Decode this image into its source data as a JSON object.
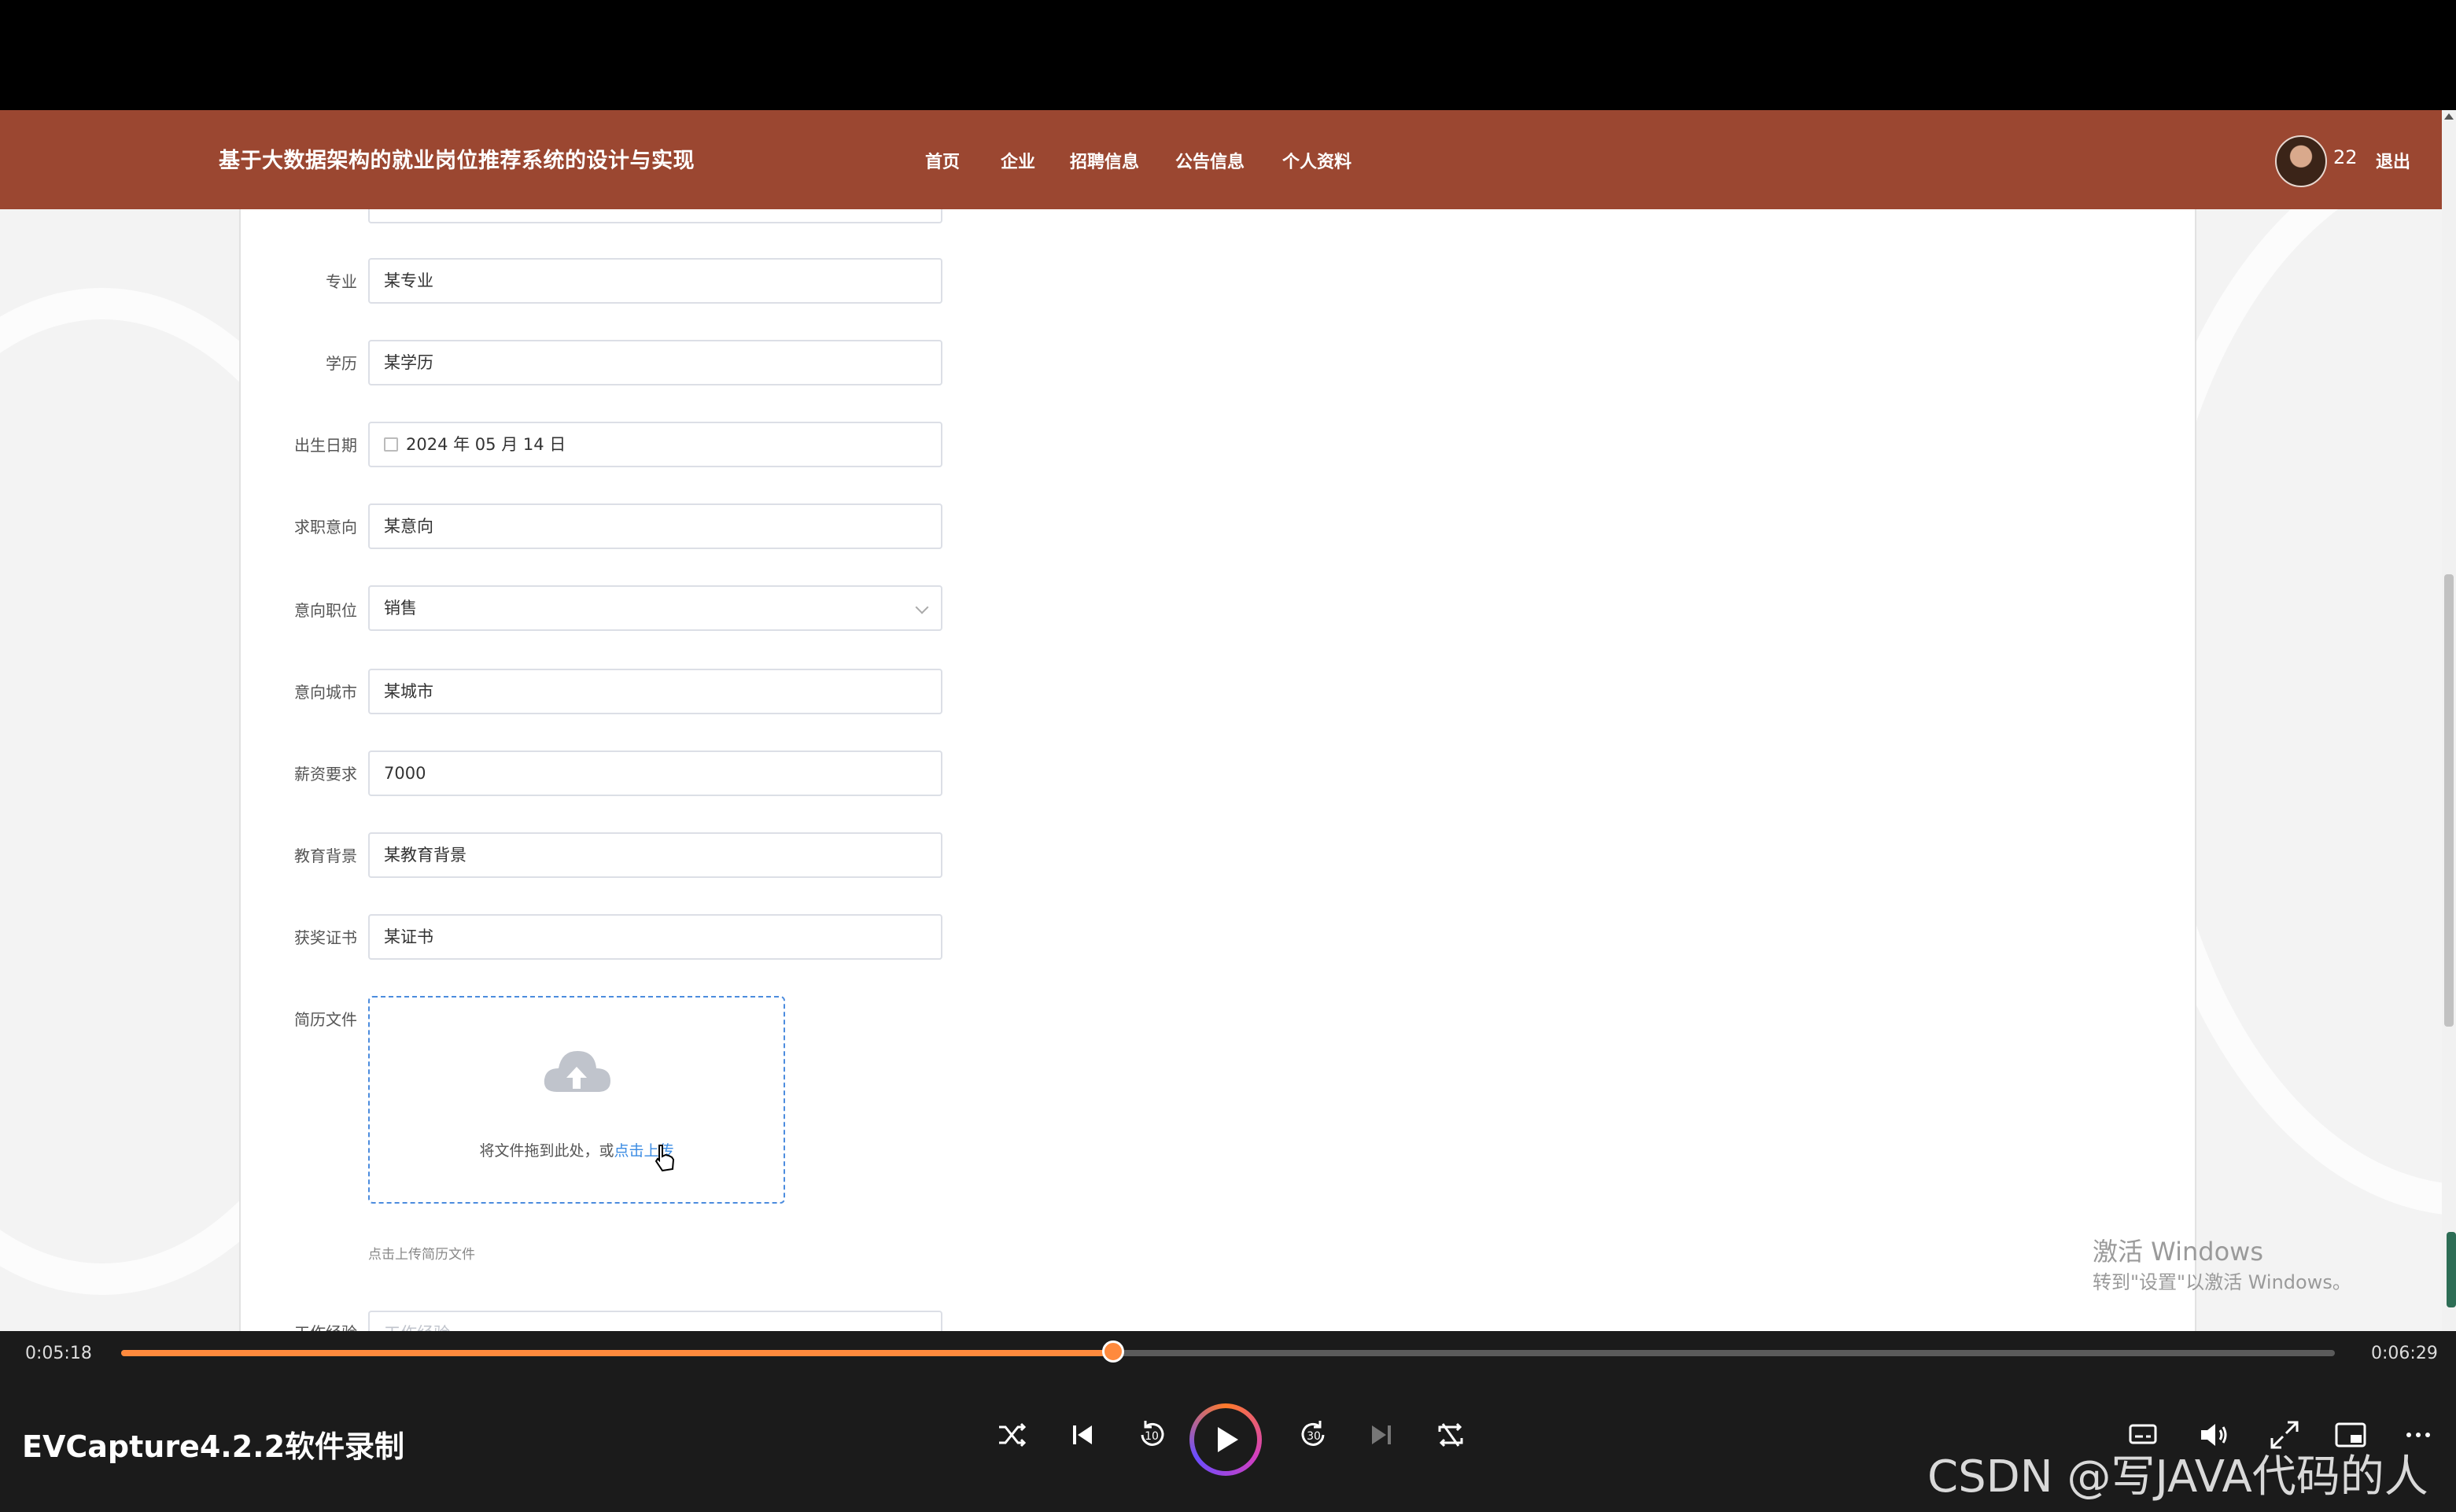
{
  "site": {
    "title": "基于大数据架构的就业岗位推荐系统的设计与实现",
    "nav": [
      "首页",
      "企业",
      "招聘信息",
      "公告信息",
      "个人资料"
    ],
    "user_name": "22",
    "logout": "退出"
  },
  "form": {
    "major_label": "专业",
    "major_value": "某专业",
    "education_label": "学历",
    "education_value": "某学历",
    "birthdate_label": "出生日期",
    "birthdate_value": "2024 年 05 月 14 日",
    "intention_label": "求职意向",
    "intention_value": "某意向",
    "position_label": "意向职位",
    "position_value": "销售",
    "city_label": "意向城市",
    "city_value": "某城市",
    "salary_label": "薪资要求",
    "salary_value": "7000",
    "background_label": "教育背景",
    "background_value": "某教育背景",
    "certificate_label": "获奖证书",
    "certificate_value": "某证书",
    "resume_label": "简历文件",
    "upload_text": "将文件拖到此处，或",
    "upload_link": "点击上传",
    "upload_tip": "点击上传简历文件",
    "experience_label": "工作经验",
    "experience_placeholder": "工作经验"
  },
  "watermark": {
    "title": "激活 Windows",
    "subtitle": "转到\"设置\"以激活 Windows。"
  },
  "player": {
    "current_time": "0:05:18",
    "total_time": "0:06:29",
    "progress": 0.448,
    "title": "EVCapture4.2.2软件录制",
    "csdn_watermark": "CSDN @写JAVA代码的人"
  },
  "colors": {
    "header": "#9b4731",
    "accent": "#ff8a3d",
    "link": "#3a8be3"
  },
  "icons": [
    "upload-cloud-icon",
    "calendar-icon",
    "chevron-down-icon",
    "hand-pointer-icon",
    "shuffle-icon",
    "previous-icon",
    "rewind-10-icon",
    "play-icon",
    "forward-30-icon",
    "next-icon",
    "repeat-icon",
    "subtitles-icon",
    "volume-icon",
    "expand-icon",
    "pip-icon",
    "more-icon"
  ]
}
